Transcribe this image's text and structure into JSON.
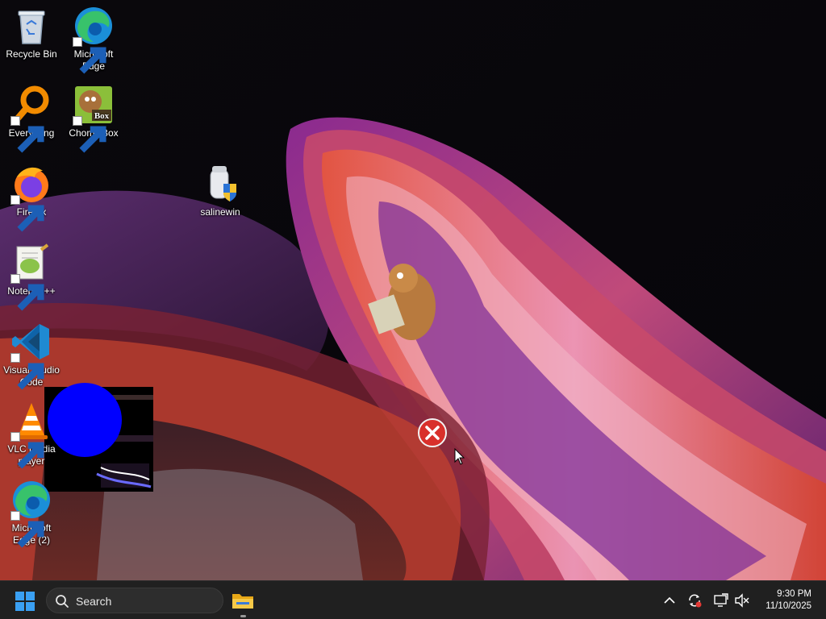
{
  "desktop": {
    "icons": [
      {
        "label": "Recycle Bin",
        "icon": "recycle-bin-icon",
        "shortcut": false
      },
      {
        "label": "Microsoft Edge",
        "icon": "edge-icon",
        "shortcut": true
      },
      {
        "label": "Everything",
        "icon": "everything-search-icon",
        "shortcut": true
      },
      {
        "label": "ChomikBox",
        "icon": "chomikbox-icon",
        "shortcut": true
      },
      {
        "label": "Firefox",
        "icon": "firefox-icon",
        "shortcut": true
      },
      {
        "label": "salinewin",
        "icon": "salinewin-icon",
        "shortcut": false
      },
      {
        "label": "Notepad++",
        "icon": "notepadpp-icon",
        "shortcut": true
      },
      {
        "label": "Visual Studio Code",
        "icon": "vscode-icon",
        "shortcut": true
      },
      {
        "label": "VLC media player",
        "icon": "vlc-icon",
        "shortcut": true
      },
      {
        "label": "Microsoft Edge (2)",
        "icon": "edge-icon",
        "shortcut": true
      }
    ]
  },
  "taskbar": {
    "search_placeholder": "Search",
    "clock_time": "9:30 PM",
    "clock_date": "11/10/2025",
    "pinned": [
      "file-explorer-icon"
    ],
    "tray": [
      "chevron-up-icon",
      "sync-icon",
      "display-icon",
      "speaker-muted-icon"
    ]
  },
  "colors": {
    "taskbar_bg": "#202020",
    "start_blue": "#3aa0f3",
    "blue_circle": "#0000ff",
    "error_red": "#d9302b"
  }
}
